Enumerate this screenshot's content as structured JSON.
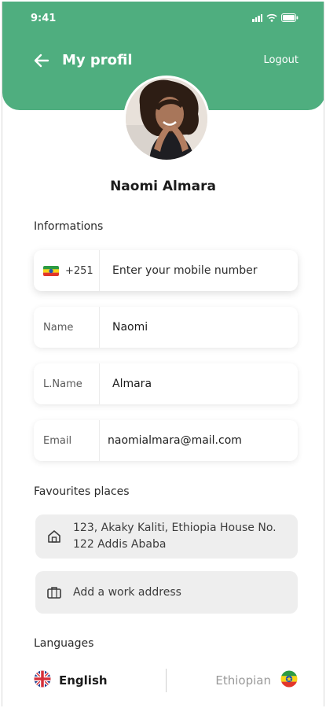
{
  "status": {
    "time": "9:41"
  },
  "header": {
    "title": "My profil",
    "logout_label": "Logout",
    "color": "#4fae7f"
  },
  "profile": {
    "name": "Naomi Almara"
  },
  "informations": {
    "title": "Informations",
    "phone": {
      "code": "+251",
      "placeholder": "Enter your mobile number"
    },
    "fields": [
      {
        "label": "Name",
        "value": "Naomi"
      },
      {
        "label": "L.Name",
        "value": "Almara"
      },
      {
        "label": "Email",
        "value": "naomialmara@mail.com"
      }
    ]
  },
  "favourites": {
    "title": "Favourites places",
    "home_line1": "123, Akaky Kaliti, Ethiopia House No.",
    "home_line2": "122  Addis Ababa",
    "work": "Add a work address"
  },
  "languages": {
    "title": "Languages",
    "selected": "English",
    "other": "Ethiopian"
  }
}
